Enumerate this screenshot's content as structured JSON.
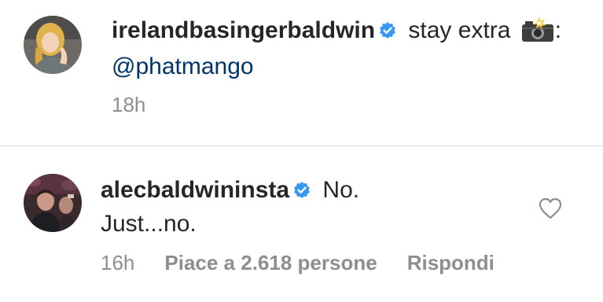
{
  "caption": {
    "username": "irelandbasingerbaldwin",
    "verified": true,
    "text_before": " stay extra ",
    "emoji": "camera-with-flash",
    "text_after": ": ",
    "mention": "@phatmango",
    "time": "18h"
  },
  "reply": {
    "username": "alecbaldwininsta",
    "verified": true,
    "text_line1": " No.",
    "text_line2": "Just...no.",
    "time": "16h",
    "likes": "Piace a 2.618 persone",
    "reply_label": "Rispondi",
    "liked": false
  },
  "colors": {
    "text": "#262626",
    "secondary": "#8e8e8e",
    "verified_badge": "#3897f0",
    "mention": "#003569",
    "divider": "#dbdbdb"
  }
}
